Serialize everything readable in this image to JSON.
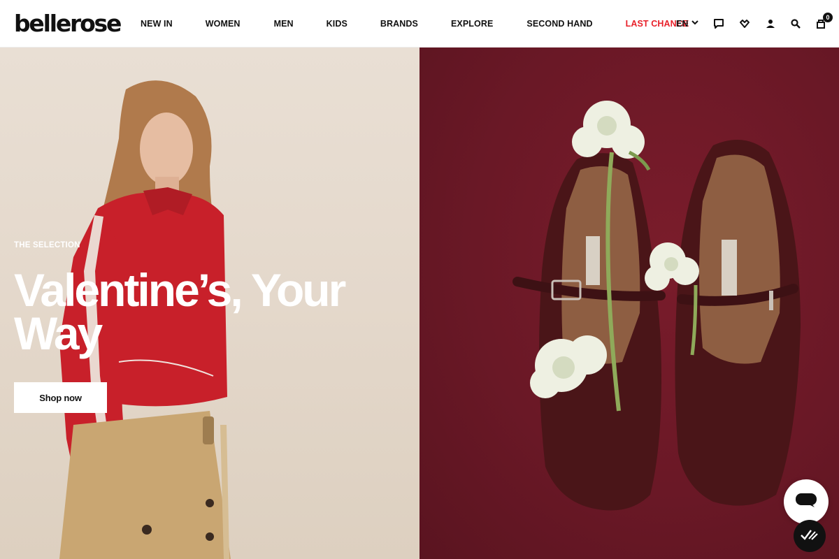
{
  "header": {
    "logo": "bellerose",
    "nav": [
      {
        "label": "NEW IN",
        "sale": false
      },
      {
        "label": "WOMEN",
        "sale": false
      },
      {
        "label": "MEN",
        "sale": false
      },
      {
        "label": "KIDS",
        "sale": false
      },
      {
        "label": "BRANDS",
        "sale": false
      },
      {
        "label": "EXPLORE",
        "sale": false
      },
      {
        "label": "SECOND HAND",
        "sale": false
      },
      {
        "label": "LAST CHANCE",
        "sale": true
      }
    ],
    "language": "EN",
    "cart_count": "0",
    "icons": [
      "chat-icon",
      "wishlist-heart-icon",
      "account-icon",
      "search-icon",
      "cart-icon"
    ]
  },
  "hero": {
    "eyebrow": "THE SELECTION",
    "headline": "Valentine’s, Your Way",
    "cta_label": "Shop now",
    "left_image": "woman-red-track-jacket-photo",
    "right_image": "woven-mary-jane-shoes-with-white-flowers-photo"
  },
  "colors": {
    "accent_sale": "#e8202a",
    "text": "#111111",
    "right_panel_bg": "#6a1826",
    "left_panel_bg": "#e4d8cb"
  },
  "floating": {
    "chat_icon": "chat-bubble-icon",
    "consent_icon": "cookie-consent-check-icon"
  }
}
